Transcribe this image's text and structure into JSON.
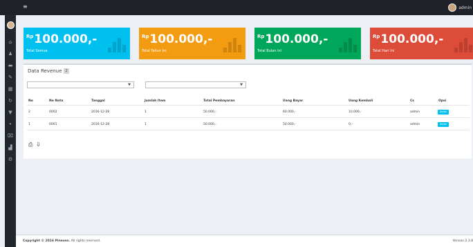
{
  "topbar": {
    "hamburger": "≡",
    "user": "admin"
  },
  "sidebar": {
    "icons": [
      "dashboard-icon",
      "user-icon",
      "list-icon",
      "tag-icon",
      "table-icon",
      "refresh-icon",
      "cart-icon",
      "dot-icon",
      "trash-icon",
      "chart-icon",
      "settings-icon"
    ],
    "glyphs": [
      "⌂",
      "♟",
      "▬",
      "✎",
      "▦",
      "↻",
      "▼",
      "•",
      "⌧",
      "▟",
      "⚙"
    ]
  },
  "tiles": [
    {
      "currency": "Rp",
      "value": "100.000,-",
      "label": "Total Semua",
      "color": "#00c0ef"
    },
    {
      "currency": "Rp",
      "value": "100.000,-",
      "label": "Total Tahun Ini",
      "color": "#f39c12"
    },
    {
      "currency": "Rp",
      "value": "100.000,-",
      "label": "Total Bulan Ini",
      "color": "#00a65a"
    },
    {
      "currency": "Rp",
      "value": "100.000,-",
      "label": "Total Hari Ini",
      "color": "#dd4b39"
    }
  ],
  "box": {
    "title": "Data Revenue",
    "badge": "2",
    "filter1": "",
    "filter2": ""
  },
  "table": {
    "headers": [
      "No",
      "No Nota",
      "Tanggal",
      "Jumlah Item",
      "Total Pembayaran",
      "Uang Bayar",
      "Uang Kembali",
      "Cs",
      "Opsi"
    ],
    "rows": [
      [
        "2",
        "0002",
        "2016-12-28",
        "1",
        "50.000,-",
        "60.000,-",
        "10.000,-",
        "admin",
        "Detail"
      ],
      [
        "1",
        "0001",
        "2016-12-28",
        "1",
        "50.000,-",
        "50.000,-",
        "0,-",
        "admin",
        "Detail"
      ]
    ]
  },
  "tools": {
    "print": "⎙",
    "export": "⇩"
  },
  "footer": {
    "copyright": "Copyright © 2016 Pinesen.",
    "rights": "All rights reserved.",
    "version": "Version 2.3.8"
  }
}
